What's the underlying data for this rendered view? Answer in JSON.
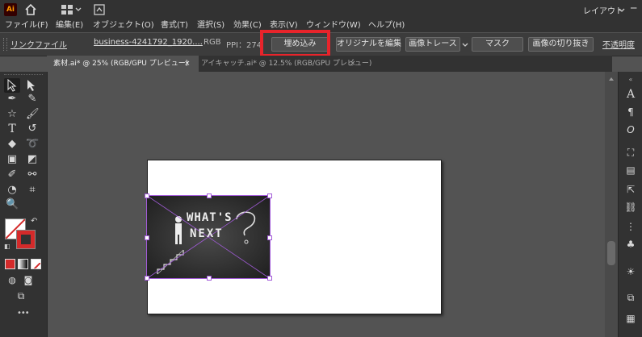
{
  "app": {
    "logo": "Ai",
    "workspace": "レイアウト"
  },
  "menu": [
    "ファイル(F)",
    "編集(E)",
    "オブジェクト(O)",
    "書式(T)",
    "選択(S)",
    "効果(C)",
    "表示(V)",
    "ウィンドウ(W)",
    "ヘルプ(H)"
  ],
  "control": {
    "linked_file": "リンクファイル",
    "filename": "business-4241792_1920....",
    "color_mode": "RGB",
    "ppi": "PPI：274",
    "embed": "埋め込み",
    "edit_original": "オリジナルを編集",
    "image_trace": "画像トレース",
    "mask": "マスク",
    "crop_image": "画像の切り抜き",
    "opacity": "不透明度"
  },
  "tabs": [
    {
      "label": "素材.ai* @ 25% (RGB/GPU プレビュー)",
      "close": "×"
    },
    {
      "label": "アイキャッチ.ai* @ 12.5% (RGB/GPU プレビュー)",
      "close": "×"
    }
  ],
  "image": {
    "text_line1": "WHAT'S",
    "text_line2": "NEXT",
    "glyph": "?"
  },
  "colors": {
    "highlight": "#e8242b",
    "selection": "#a25bd9",
    "accent_red": "#d42a2a"
  },
  "toolbar_more": "•••"
}
